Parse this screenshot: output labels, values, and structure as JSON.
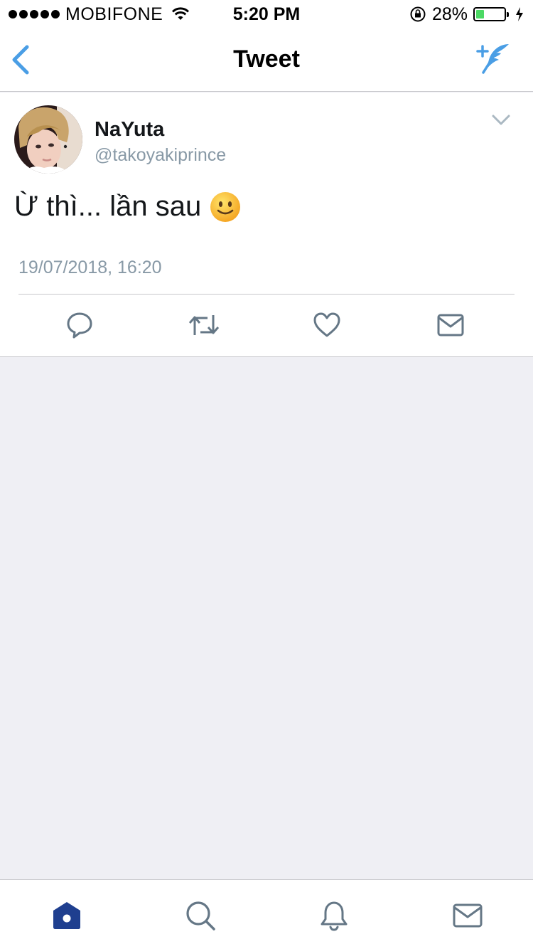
{
  "status_bar": {
    "carrier": "MOBIFONE",
    "time": "5:20 PM",
    "battery_percent": "28%",
    "battery_level": 0.28,
    "battery_color": "#4cd964",
    "icons": [
      "signal-dots-icon",
      "wifi-icon",
      "orientation-lock-icon",
      "battery-icon",
      "charging-bolt-icon"
    ]
  },
  "nav": {
    "title": "Tweet",
    "back_icon": "chevron-left-icon",
    "compose_icon": "compose-feather-icon",
    "accent_color": "#4a9ee5"
  },
  "tweet": {
    "display_name": "NaYuta",
    "handle": "@takoyakiprince",
    "text": "Ừ thì... lần sau",
    "emoji": "slightly-smiling-face-emoji",
    "timestamp": "19/07/2018, 16:20",
    "menu_icon": "chevron-down-icon",
    "actions": [
      "reply-icon",
      "retweet-icon",
      "like-icon",
      "direct-message-icon"
    ]
  },
  "tab_bar": {
    "items": [
      {
        "name": "home",
        "icon": "home-icon",
        "active": true
      },
      {
        "name": "search",
        "icon": "search-icon",
        "active": false
      },
      {
        "name": "notifications",
        "icon": "bell-icon",
        "active": false
      },
      {
        "name": "messages",
        "icon": "envelope-icon",
        "active": false
      }
    ],
    "active_color": "#1f3f8f",
    "inactive_color": "#657786"
  }
}
